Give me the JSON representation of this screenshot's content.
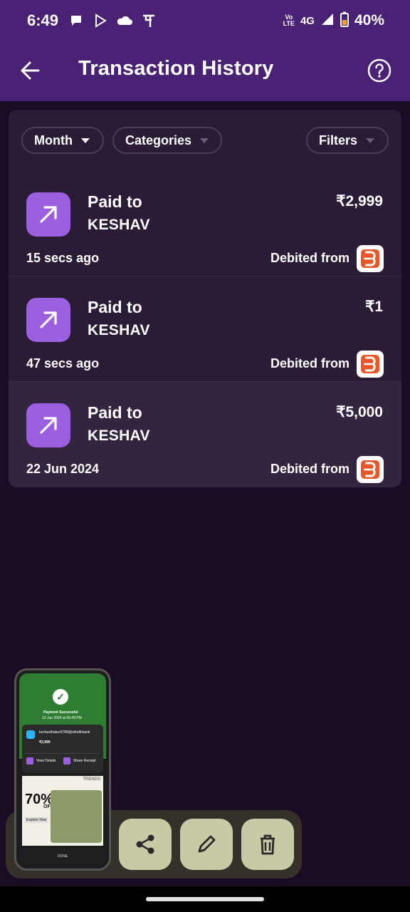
{
  "status_bar": {
    "time": "6:49",
    "volte_line1": "Vo",
    "volte_line2": "LTE",
    "network": "4G",
    "battery": "40%",
    "notif_icons": [
      "chat-bubble-icon",
      "play-store-icon",
      "cloud-icon",
      "phonepe-icon"
    ]
  },
  "header": {
    "title": "Transaction History"
  },
  "filters": {
    "month": "Month",
    "categories": "Categories",
    "filters": "Filters"
  },
  "transactions": [
    {
      "type": "Paid to",
      "name": "KESHAV",
      "amount": "₹2,999",
      "time": "15 secs ago",
      "debit_label": "Debited from"
    },
    {
      "type": "Paid to",
      "name": "KESHAV",
      "amount": "₹1",
      "time": "47 secs ago",
      "debit_label": "Debited from"
    },
    {
      "type": "Paid to",
      "name": "KESHAV",
      "amount": "₹5,000",
      "time": "22 Jun 2024",
      "debit_label": "Debited from"
    }
  ],
  "screenshot_preview": {
    "status": "Payment Successful",
    "date": "12 Jun 2024 at 06:49 PM",
    "upi": "keshavthakur6788@okhdfcbank",
    "amount": "₹2,999",
    "view_details": "View Details",
    "share_receipt": "Share Receipt",
    "ad_brand": "TRENDS",
    "ad_discount": "70%",
    "ad_off": "OFF",
    "ad_cta": "Explore Now",
    "done": "DONE"
  },
  "colors": {
    "header_bg": "#4a2275",
    "page_bg": "#1a0c24",
    "card_bg": "#2a1c36",
    "accent": "#9b5fe0",
    "bank": "#e8562a"
  }
}
